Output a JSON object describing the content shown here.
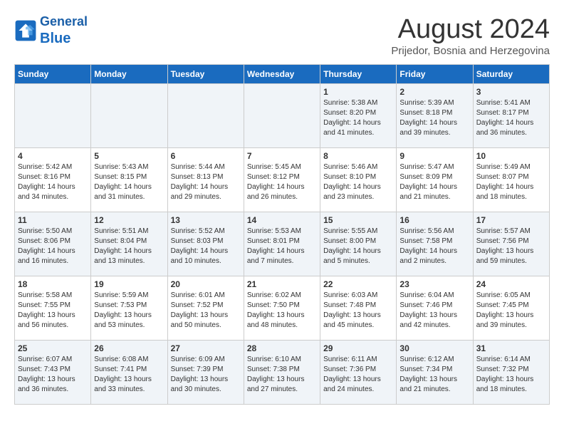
{
  "header": {
    "logo_line1": "General",
    "logo_line2": "Blue",
    "month_year": "August 2024",
    "location": "Prijedor, Bosnia and Herzegovina"
  },
  "weekdays": [
    "Sunday",
    "Monday",
    "Tuesday",
    "Wednesday",
    "Thursday",
    "Friday",
    "Saturday"
  ],
  "weeks": [
    [
      {
        "day": "",
        "info": ""
      },
      {
        "day": "",
        "info": ""
      },
      {
        "day": "",
        "info": ""
      },
      {
        "day": "",
        "info": ""
      },
      {
        "day": "1",
        "info": "Sunrise: 5:38 AM\nSunset: 8:20 PM\nDaylight: 14 hours\nand 41 minutes."
      },
      {
        "day": "2",
        "info": "Sunrise: 5:39 AM\nSunset: 8:18 PM\nDaylight: 14 hours\nand 39 minutes."
      },
      {
        "day": "3",
        "info": "Sunrise: 5:41 AM\nSunset: 8:17 PM\nDaylight: 14 hours\nand 36 minutes."
      }
    ],
    [
      {
        "day": "4",
        "info": "Sunrise: 5:42 AM\nSunset: 8:16 PM\nDaylight: 14 hours\nand 34 minutes."
      },
      {
        "day": "5",
        "info": "Sunrise: 5:43 AM\nSunset: 8:15 PM\nDaylight: 14 hours\nand 31 minutes."
      },
      {
        "day": "6",
        "info": "Sunrise: 5:44 AM\nSunset: 8:13 PM\nDaylight: 14 hours\nand 29 minutes."
      },
      {
        "day": "7",
        "info": "Sunrise: 5:45 AM\nSunset: 8:12 PM\nDaylight: 14 hours\nand 26 minutes."
      },
      {
        "day": "8",
        "info": "Sunrise: 5:46 AM\nSunset: 8:10 PM\nDaylight: 14 hours\nand 23 minutes."
      },
      {
        "day": "9",
        "info": "Sunrise: 5:47 AM\nSunset: 8:09 PM\nDaylight: 14 hours\nand 21 minutes."
      },
      {
        "day": "10",
        "info": "Sunrise: 5:49 AM\nSunset: 8:07 PM\nDaylight: 14 hours\nand 18 minutes."
      }
    ],
    [
      {
        "day": "11",
        "info": "Sunrise: 5:50 AM\nSunset: 8:06 PM\nDaylight: 14 hours\nand 16 minutes."
      },
      {
        "day": "12",
        "info": "Sunrise: 5:51 AM\nSunset: 8:04 PM\nDaylight: 14 hours\nand 13 minutes."
      },
      {
        "day": "13",
        "info": "Sunrise: 5:52 AM\nSunset: 8:03 PM\nDaylight: 14 hours\nand 10 minutes."
      },
      {
        "day": "14",
        "info": "Sunrise: 5:53 AM\nSunset: 8:01 PM\nDaylight: 14 hours\nand 7 minutes."
      },
      {
        "day": "15",
        "info": "Sunrise: 5:55 AM\nSunset: 8:00 PM\nDaylight: 14 hours\nand 5 minutes."
      },
      {
        "day": "16",
        "info": "Sunrise: 5:56 AM\nSunset: 7:58 PM\nDaylight: 14 hours\nand 2 minutes."
      },
      {
        "day": "17",
        "info": "Sunrise: 5:57 AM\nSunset: 7:56 PM\nDaylight: 13 hours\nand 59 minutes."
      }
    ],
    [
      {
        "day": "18",
        "info": "Sunrise: 5:58 AM\nSunset: 7:55 PM\nDaylight: 13 hours\nand 56 minutes."
      },
      {
        "day": "19",
        "info": "Sunrise: 5:59 AM\nSunset: 7:53 PM\nDaylight: 13 hours\nand 53 minutes."
      },
      {
        "day": "20",
        "info": "Sunrise: 6:01 AM\nSunset: 7:52 PM\nDaylight: 13 hours\nand 50 minutes."
      },
      {
        "day": "21",
        "info": "Sunrise: 6:02 AM\nSunset: 7:50 PM\nDaylight: 13 hours\nand 48 minutes."
      },
      {
        "day": "22",
        "info": "Sunrise: 6:03 AM\nSunset: 7:48 PM\nDaylight: 13 hours\nand 45 minutes."
      },
      {
        "day": "23",
        "info": "Sunrise: 6:04 AM\nSunset: 7:46 PM\nDaylight: 13 hours\nand 42 minutes."
      },
      {
        "day": "24",
        "info": "Sunrise: 6:05 AM\nSunset: 7:45 PM\nDaylight: 13 hours\nand 39 minutes."
      }
    ],
    [
      {
        "day": "25",
        "info": "Sunrise: 6:07 AM\nSunset: 7:43 PM\nDaylight: 13 hours\nand 36 minutes."
      },
      {
        "day": "26",
        "info": "Sunrise: 6:08 AM\nSunset: 7:41 PM\nDaylight: 13 hours\nand 33 minutes."
      },
      {
        "day": "27",
        "info": "Sunrise: 6:09 AM\nSunset: 7:39 PM\nDaylight: 13 hours\nand 30 minutes."
      },
      {
        "day": "28",
        "info": "Sunrise: 6:10 AM\nSunset: 7:38 PM\nDaylight: 13 hours\nand 27 minutes."
      },
      {
        "day": "29",
        "info": "Sunrise: 6:11 AM\nSunset: 7:36 PM\nDaylight: 13 hours\nand 24 minutes."
      },
      {
        "day": "30",
        "info": "Sunrise: 6:12 AM\nSunset: 7:34 PM\nDaylight: 13 hours\nand 21 minutes."
      },
      {
        "day": "31",
        "info": "Sunrise: 6:14 AM\nSunset: 7:32 PM\nDaylight: 13 hours\nand 18 minutes."
      }
    ]
  ]
}
